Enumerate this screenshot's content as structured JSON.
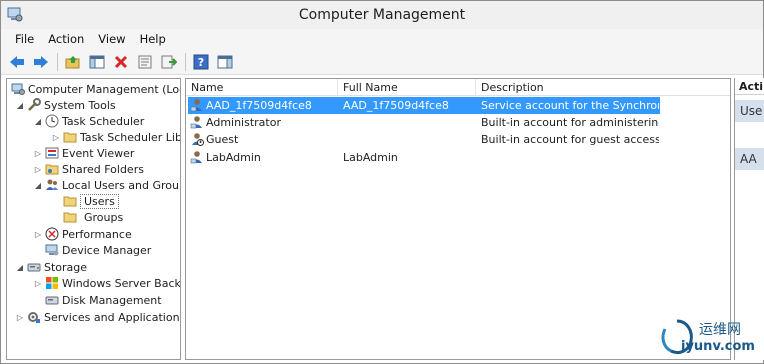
{
  "window": {
    "title": "Computer Management"
  },
  "menubar": {
    "items": [
      "File",
      "Action",
      "View",
      "Help"
    ]
  },
  "toolbar": {
    "buttons": [
      "back-icon",
      "forward-icon",
      "up-folder-icon",
      "show-hide-tree-icon",
      "delete-icon",
      "properties-icon",
      "export-list-icon",
      "help-icon",
      "show-action-pane-icon"
    ]
  },
  "tree": {
    "items": [
      {
        "label": "Computer Management (Local",
        "icon": "computer-management-icon"
      },
      {
        "label": "System Tools",
        "icon": "tools-icon"
      },
      {
        "label": "Task Scheduler",
        "icon": "clock-icon"
      },
      {
        "label": "Task Scheduler Libra",
        "icon": "folder-icon"
      },
      {
        "label": "Event Viewer",
        "icon": "event-viewer-icon"
      },
      {
        "label": "Shared Folders",
        "icon": "shared-folders-icon"
      },
      {
        "label": "Local Users and Groups",
        "icon": "users-groups-icon"
      },
      {
        "label": "Users",
        "icon": "folder-icon"
      },
      {
        "label": "Groups",
        "icon": "folder-icon"
      },
      {
        "label": "Performance",
        "icon": "performance-icon"
      },
      {
        "label": "Device Manager",
        "icon": "device-manager-icon"
      },
      {
        "label": "Storage",
        "icon": "storage-icon"
      },
      {
        "label": "Windows Server Backup",
        "icon": "backup-icon"
      },
      {
        "label": "Disk Management",
        "icon": "disk-icon"
      },
      {
        "label": "Services and Applications",
        "icon": "services-icon"
      }
    ]
  },
  "list": {
    "columns": [
      "Name",
      "Full Name",
      "Description"
    ],
    "rows": [
      {
        "name": "AAD_1f7509d4fce8",
        "full_name": "AAD_1f7509d4fce8",
        "description": "Service account for the Synchroni..."
      },
      {
        "name": "Administrator",
        "full_name": "",
        "description": "Built-in account for administering..."
      },
      {
        "name": "Guest",
        "full_name": "",
        "description": "Built-in account for guest access t..."
      },
      {
        "name": "LabAdmin",
        "full_name": "LabAdmin",
        "description": ""
      }
    ]
  },
  "actions": {
    "header": "Acti",
    "band1": "Use",
    "band2": "AA"
  },
  "watermark": {
    "cn": "运维网",
    "url": "iyunv.com"
  },
  "colors": {
    "selection": "#3399ff",
    "action_band": "#d6e0ec"
  }
}
